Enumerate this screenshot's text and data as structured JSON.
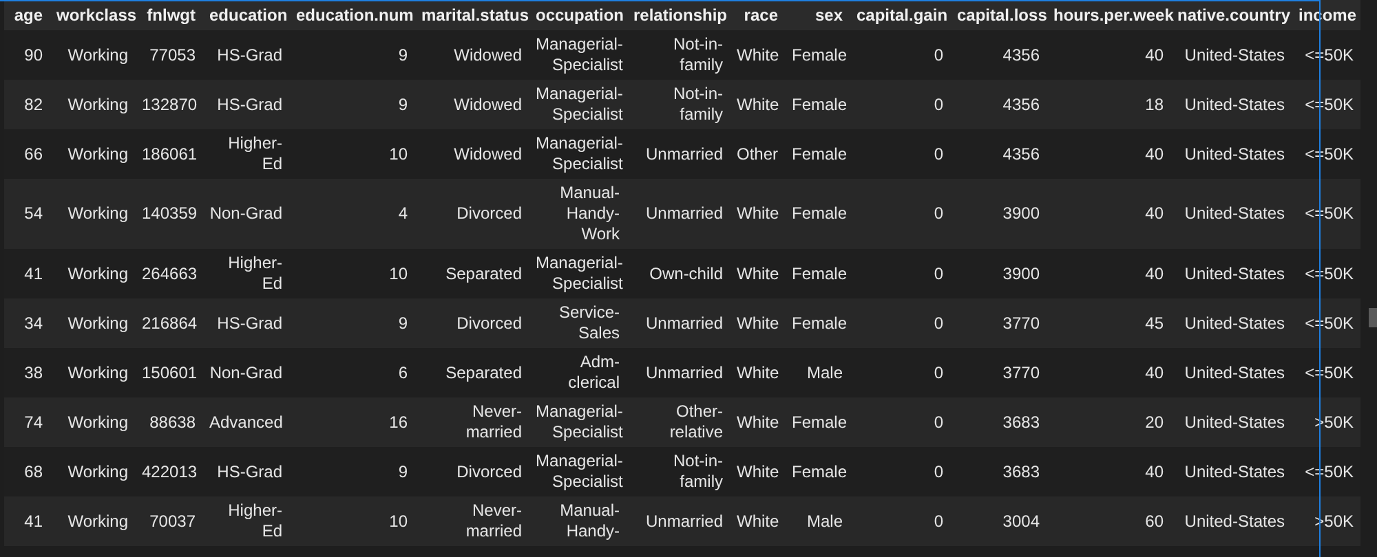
{
  "table": {
    "columns": [
      "age",
      "workclass",
      "fnlwgt",
      "education",
      "education.num",
      "marital.status",
      "occupation",
      "relationship",
      "race",
      "sex",
      "capital.gain",
      "capital.loss",
      "hours.per.week",
      "native.country",
      "income"
    ],
    "rows": [
      [
        "90",
        "Working",
        "77053",
        "HS-Grad",
        "9",
        "Widowed",
        "Managerial-Specialist",
        "Not-in-family",
        "White",
        "Female",
        "0",
        "4356",
        "40",
        "United-States",
        "<=50K"
      ],
      [
        "82",
        "Working",
        "132870",
        "HS-Grad",
        "9",
        "Widowed",
        "Managerial-Specialist",
        "Not-in-family",
        "White",
        "Female",
        "0",
        "4356",
        "18",
        "United-States",
        "<=50K"
      ],
      [
        "66",
        "Working",
        "186061",
        "Higher-Ed",
        "10",
        "Widowed",
        "Managerial-Specialist",
        "Unmarried",
        "Other",
        "Female",
        "0",
        "4356",
        "40",
        "United-States",
        "<=50K"
      ],
      [
        "54",
        "Working",
        "140359",
        "Non-Grad",
        "4",
        "Divorced",
        "Manual-Handy-Work",
        "Unmarried",
        "White",
        "Female",
        "0",
        "3900",
        "40",
        "United-States",
        "<=50K"
      ],
      [
        "41",
        "Working",
        "264663",
        "Higher-Ed",
        "10",
        "Separated",
        "Managerial-Specialist",
        "Own-child",
        "White",
        "Female",
        "0",
        "3900",
        "40",
        "United-States",
        "<=50K"
      ],
      [
        "34",
        "Working",
        "216864",
        "HS-Grad",
        "9",
        "Divorced",
        "Service-Sales",
        "Unmarried",
        "White",
        "Female",
        "0",
        "3770",
        "45",
        "United-States",
        "<=50K"
      ],
      [
        "38",
        "Working",
        "150601",
        "Non-Grad",
        "6",
        "Separated",
        "Adm-clerical",
        "Unmarried",
        "White",
        "Male",
        "0",
        "3770",
        "40",
        "United-States",
        "<=50K"
      ],
      [
        "74",
        "Working",
        "88638",
        "Advanced",
        "16",
        "Never-married",
        "Managerial-Specialist",
        "Other-relative",
        "White",
        "Female",
        "0",
        "3683",
        "20",
        "United-States",
        ">50K"
      ],
      [
        "68",
        "Working",
        "422013",
        "HS-Grad",
        "9",
        "Divorced",
        "Managerial-Specialist",
        "Not-in-family",
        "White",
        "Female",
        "0",
        "3683",
        "40",
        "United-States",
        "<=50K"
      ],
      [
        "41",
        "Working",
        "70037",
        "Higher-Ed",
        "10",
        "Never-married",
        "Manual-Handy-",
        "Unmarried",
        "White",
        "Male",
        "0",
        "3004",
        "60",
        "United-States",
        ">50K"
      ]
    ]
  }
}
